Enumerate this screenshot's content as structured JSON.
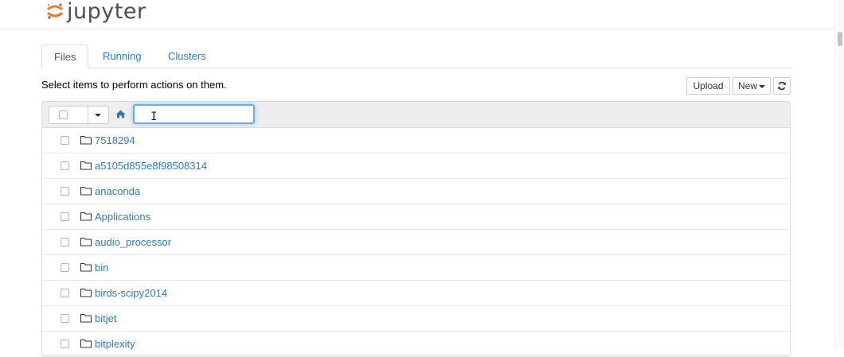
{
  "header": {
    "logo_text": "jupyter",
    "logo_icon": "jupyter-logo-icon",
    "logo_color": "#f37726"
  },
  "tabs": [
    {
      "label": "Files",
      "active": true
    },
    {
      "label": "Running",
      "active": false
    },
    {
      "label": "Clusters",
      "active": false
    }
  ],
  "toolbar": {
    "hint": "Select items to perform actions on them.",
    "upload_label": "Upload",
    "new_label": "New",
    "refresh_icon": "refresh-icon"
  },
  "list_header": {
    "home_icon": "home-icon",
    "path_value": ""
  },
  "files": [
    {
      "name": "7518294",
      "type": "folder"
    },
    {
      "name": "a5105d855e8f98508314",
      "type": "folder"
    },
    {
      "name": "anaconda",
      "type": "folder"
    },
    {
      "name": "Applications",
      "type": "folder"
    },
    {
      "name": "audio_processor",
      "type": "folder"
    },
    {
      "name": "bin",
      "type": "folder"
    },
    {
      "name": "birds-scipy2014",
      "type": "folder"
    },
    {
      "name": "bitjet",
      "type": "folder"
    },
    {
      "name": "bitplexity",
      "type": "folder"
    }
  ],
  "colors": {
    "link": "#337ab7",
    "focus_ring": "#66afe9",
    "header_bg": "#eeeeee"
  }
}
